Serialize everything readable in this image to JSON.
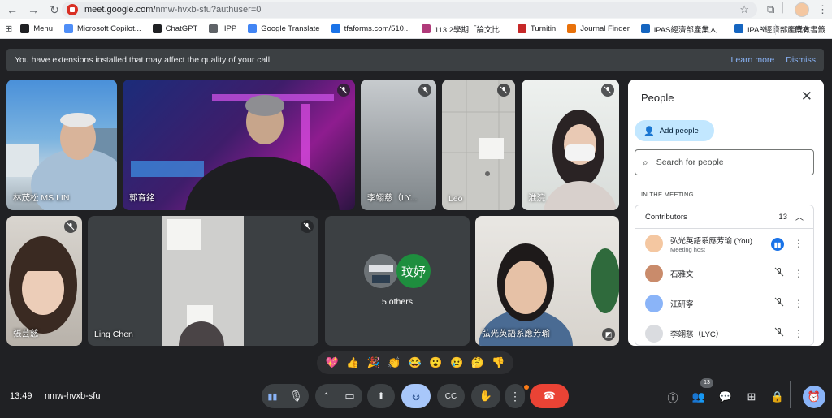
{
  "browser": {
    "url_host": "meet.google.com/",
    "url_path": "nmw-hvxb-sfu?authuser=0",
    "bookmarks": [
      {
        "label": "Menu",
        "color": "#202124"
      },
      {
        "label": "Microsoft Copilot...",
        "color": "#4f8ef7"
      },
      {
        "label": "ChatGPT",
        "color": "#202124"
      },
      {
        "label": "IIPP",
        "color": "#5f6368"
      },
      {
        "label": "Google Translate",
        "color": "#4285f4"
      },
      {
        "label": "tfaforms.com/510...",
        "color": "#1a73e8"
      },
      {
        "label": "113.2學期「論文比...",
        "color": "#b03a7a"
      },
      {
        "label": "Turnitin",
        "color": "#c62828"
      },
      {
        "label": "Journal Finder",
        "color": "#e8710a"
      },
      {
        "label": "iPAS經濟部產業人...",
        "color": "#1565c0"
      },
      {
        "label": "iPAS經濟部產業人...",
        "color": "#1565c0"
      }
    ],
    "more": "»",
    "all_bookmarks": "所有書籤"
  },
  "banner": {
    "message": "You have extensions installed that may affect the quality of your call",
    "learn_more": "Learn more",
    "dismiss": "Dismiss"
  },
  "tiles": [
    {
      "name": "林茂松 MS LIN",
      "muted": false
    },
    {
      "name": "郭育銘",
      "muted": true
    },
    {
      "name": "李翊慈（LY...",
      "muted": true
    },
    {
      "name": "Leo",
      "muted": true
    },
    {
      "name": "淮浣",
      "muted": true
    },
    {
      "name": "張芸慈",
      "muted": true
    },
    {
      "name": "Ling Chen",
      "muted": true
    },
    {
      "name": "5 others",
      "avatar_text": "玟妤"
    },
    {
      "name": "弘光英語系應芳瑜",
      "muted": false
    }
  ],
  "people_panel": {
    "title": "People",
    "add_people": "Add people",
    "search_placeholder": "Search for people",
    "section": "IN THE MEETING",
    "contributors_label": "Contributors",
    "contributors_count": "13",
    "participants": [
      {
        "name": "弘光英語系應芳瑜 (You)",
        "sub": "Meeting host",
        "avatar_color": "#f4c7a1",
        "speaking": true
      },
      {
        "name": "石雅文",
        "sub": "",
        "avatar_color": "#c98b6b",
        "speaking": false
      },
      {
        "name": "江研寧",
        "sub": "",
        "avatar_color": "#8ab4f8",
        "speaking": false
      },
      {
        "name": "李翊慈（LYC）",
        "sub": "",
        "avatar_color": "#dadce0",
        "speaking": false
      }
    ]
  },
  "reactions": [
    "💖",
    "👍",
    "🎉",
    "👏",
    "😂",
    "😮",
    "😢",
    "🤔",
    "👎"
  ],
  "bottom_bar": {
    "time": "13:49",
    "meeting_code": "nmw-hvxb-sfu",
    "people_count": "13"
  },
  "colors": {
    "end_call": "#ea4335",
    "active_btn": "#a8c7fa",
    "panel_bg": "#ffffff",
    "meet_bg": "#202124"
  }
}
